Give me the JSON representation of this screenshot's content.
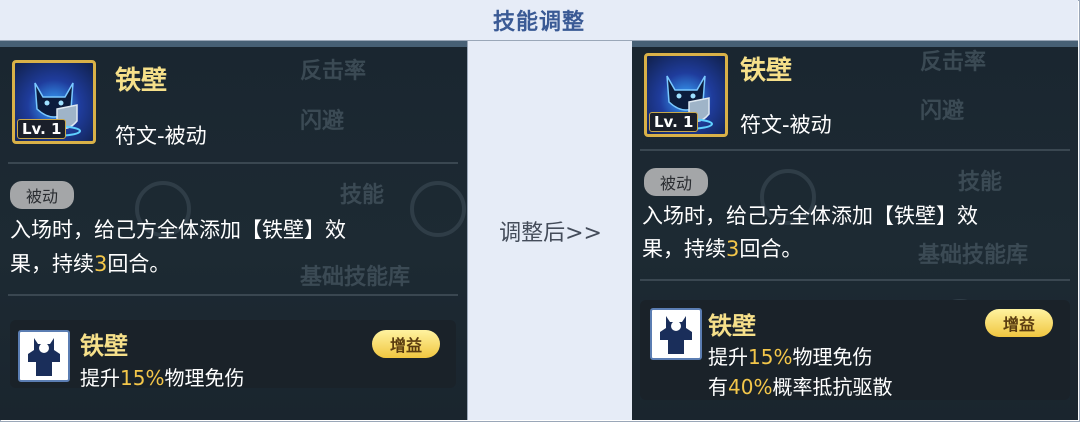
{
  "header": {
    "title": "技能调整"
  },
  "middle": {
    "label": "调整后>>"
  },
  "background_text": {
    "left": [
      "反击率",
      "闪避",
      "技能",
      "基础技能库"
    ],
    "right": [
      "反击率",
      "闪避",
      "技能",
      "基础技能库"
    ]
  },
  "before": {
    "skill_name": "铁壁",
    "skill_type": "符文-被动",
    "level": "Lv. 1",
    "tag": "被动",
    "description": {
      "line1": "入场时，给己方全体添加【铁壁】效",
      "line2_pre": "果，持续",
      "line2_num": "3",
      "line2_post": "回合。"
    },
    "buff": {
      "name": "铁壁",
      "badge": "增益",
      "effect1_pre": "提升",
      "effect1_num": "15%",
      "effect1_post": "物理免伤"
    }
  },
  "after": {
    "skill_name": "铁壁",
    "skill_type": "符文-被动",
    "level": "Lv. 1",
    "tag": "被动",
    "description": {
      "line1": "入场时，给己方全体添加【铁壁】效",
      "line2_pre": "果，持续",
      "line2_num": "3",
      "line2_post": "回合。"
    },
    "buff": {
      "name": "铁壁",
      "badge": "增益",
      "effect1_pre": "提升",
      "effect1_num": "15%",
      "effect1_post": "物理免伤",
      "effect2_pre": "有",
      "effect2_num": "40%",
      "effect2_post": "概率抵抗驱散"
    }
  },
  "colors": {
    "header_bg": "#e6ecf7",
    "header_text": "#3a5a95",
    "panel_bg": "#1d2a33",
    "gold": "#f6e08a",
    "highlight": "#f3c64a"
  }
}
